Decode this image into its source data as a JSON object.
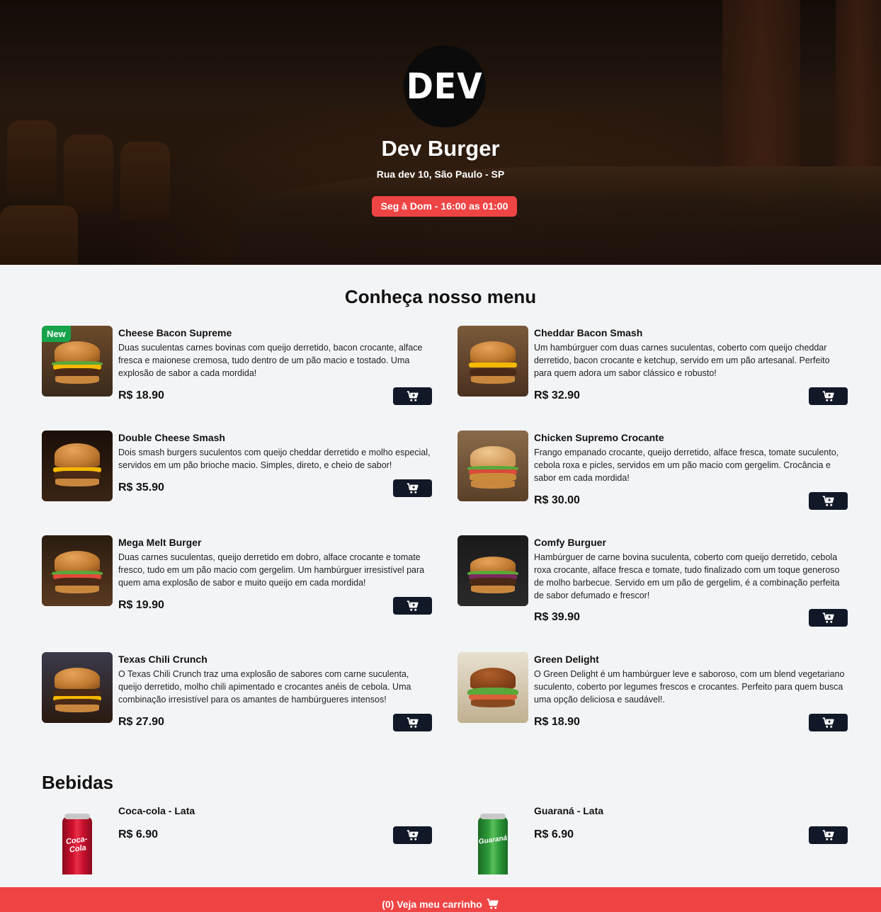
{
  "header": {
    "logo_text": "DEV",
    "title": "Dev Burger",
    "address": "Rua dev 10, São Paulo - SP",
    "hours": "Seg à Dom - 16:00 as 01:00"
  },
  "menu": {
    "title": "Conheça nosso menu",
    "new_badge": "New",
    "items": [
      {
        "name": "Cheese Bacon Supreme",
        "description": "Duas suculentas carnes bovinas com queijo derretido, bacon crocante, alface fresca e maionese cremosa, tudo dentro de um pão macio e tostado. Uma explosão de sabor a cada mordida!",
        "price": "R$ 18.90"
      },
      {
        "name": "Cheddar Bacon Smash",
        "description": "Um hambúrguer com duas carnes suculentas, coberto com queijo cheddar derretido, bacon crocante e ketchup, servido em um pão artesanal. Perfeito para quem adora um sabor clássico e robusto!",
        "price": "R$ 32.90"
      },
      {
        "name": "Double Cheese Smash",
        "description": "Dois smash burgers suculentos com queijo cheddar derretido e molho especial, servidos em um pão brioche macio. Simples, direto, e cheio de sabor!",
        "price": "R$ 35.90"
      },
      {
        "name": "Chicken Supremo Crocante",
        "description": "Frango empanado crocante, queijo derretido, alface fresca, tomate suculento, cebola roxa e picles, servidos em um pão macio com gergelim. Crocância e sabor em cada mordida!",
        "price": "R$ 30.00"
      },
      {
        "name": "Mega Melt Burger",
        "description": "Duas carnes suculentas, queijo derretido em dobro, alface crocante e tomate fresco, tudo em um pão macio com gergelim. Um hambúrguer irresistível para quem ama explosão de sabor e muito queijo em cada mordida!",
        "price": "R$ 19.90"
      },
      {
        "name": "Comfy Burguer",
        "description": "Hambúrguer de carne bovina suculenta, coberto com queijo derretido, cebola roxa crocante, alface fresca e tomate, tudo finalizado com um toque generoso de molho barbecue. Servido em um pão de gergelim, é a combinação perfeita de sabor defumado e frescor!",
        "price": "R$ 39.90"
      },
      {
        "name": "Texas Chili Crunch",
        "description": "O Texas Chili Crunch traz uma explosão de sabores com carne suculenta, queijo derretido, molho chili apimentado e crocantes anéis de cebola. Uma combinação irresistível para os amantes de hambúrgueres intensos!",
        "price": "R$ 27.90"
      },
      {
        "name": "Green Delight",
        "description": "O Green Delight é um hambúrguer leve e saboroso, com um blend vegetariano suculento, coberto por legumes frescos e crocantes. Perfeito para quem busca uma opção deliciosa e saudável!.",
        "price": "R$ 18.90"
      }
    ]
  },
  "drinks": {
    "title": "Bebidas",
    "items": [
      {
        "name": "Coca-cola - Lata",
        "price": "R$ 6.90",
        "can_label": "Coca-Cola",
        "color": "#c8102e"
      },
      {
        "name": "Guaraná - Lata",
        "price": "R$ 6.90",
        "can_label": "Guaraná",
        "color": "#2e9b3a"
      }
    ]
  },
  "footer": {
    "cart_label": "(0) Veja meu carrinho"
  },
  "colors": {
    "accent": "#ef4444",
    "button": "#111827",
    "new_badge": "#16a34a"
  },
  "icons": {
    "cart": "cart-icon"
  }
}
